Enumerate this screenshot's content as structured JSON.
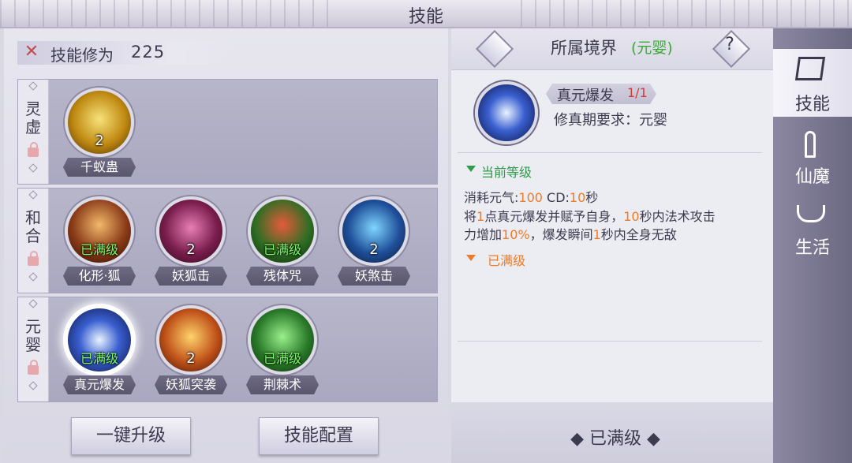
{
  "header": {
    "title": "技能"
  },
  "cultivation": {
    "label": "技能修为",
    "value": "225"
  },
  "rows": [
    {
      "label_chars": [
        "灵",
        "虚"
      ],
      "skills": [
        {
          "name": "千蚁蛊",
          "level": "2",
          "max": ""
        }
      ]
    },
    {
      "label_chars": [
        "和",
        "合"
      ],
      "skills": [
        {
          "name": "化形·狐",
          "level": "",
          "max": "已满级"
        },
        {
          "name": "妖狐击",
          "level": "2",
          "max": ""
        },
        {
          "name": "残体咒",
          "level": "",
          "max": "已满级"
        },
        {
          "name": "妖煞击",
          "level": "2",
          "max": ""
        }
      ]
    },
    {
      "label_chars": [
        "元",
        "婴"
      ],
      "skills": [
        {
          "name": "真元爆发",
          "level": "",
          "max": "已满级"
        },
        {
          "name": "妖狐突袭",
          "level": "2",
          "max": ""
        },
        {
          "name": "荆棘术",
          "level": "",
          "max": "已满级"
        }
      ]
    }
  ],
  "buttons": {
    "upgrade_all": "一键升级",
    "config": "技能配置"
  },
  "detail": {
    "realm_label": "所属境界",
    "realm_value": "(元婴)",
    "help": "?",
    "skill_name": "真元爆发",
    "skill_level": "1/1",
    "requirement": "修真期要求：元婴",
    "current_level_label": "当前等级",
    "cost_line": {
      "a": "消耗元气:",
      "b": "100",
      "c": " CD:",
      "d": "10",
      "e": "秒"
    },
    "desc_line1": {
      "a": "将",
      "b": "1",
      "c": "点真元爆发并赋予自身，",
      "d": "10",
      "e": "秒内法术攻击"
    },
    "desc_line2": {
      "a": "力增加",
      "b": "10%",
      "c": "，爆发瞬间",
      "d": "1",
      "e": "秒内全身无敌"
    },
    "max_label": "已满级",
    "max_button": "◆ 已满级 ◆"
  },
  "tabs": [
    {
      "label": "技能"
    },
    {
      "label": "仙魔"
    },
    {
      "label": "生活"
    }
  ],
  "colors": {
    "accent_green": "#2f9a4a",
    "accent_orange": "#ee7b25",
    "max_green": "#7dfc6a",
    "level_red": "#d23b3b"
  }
}
